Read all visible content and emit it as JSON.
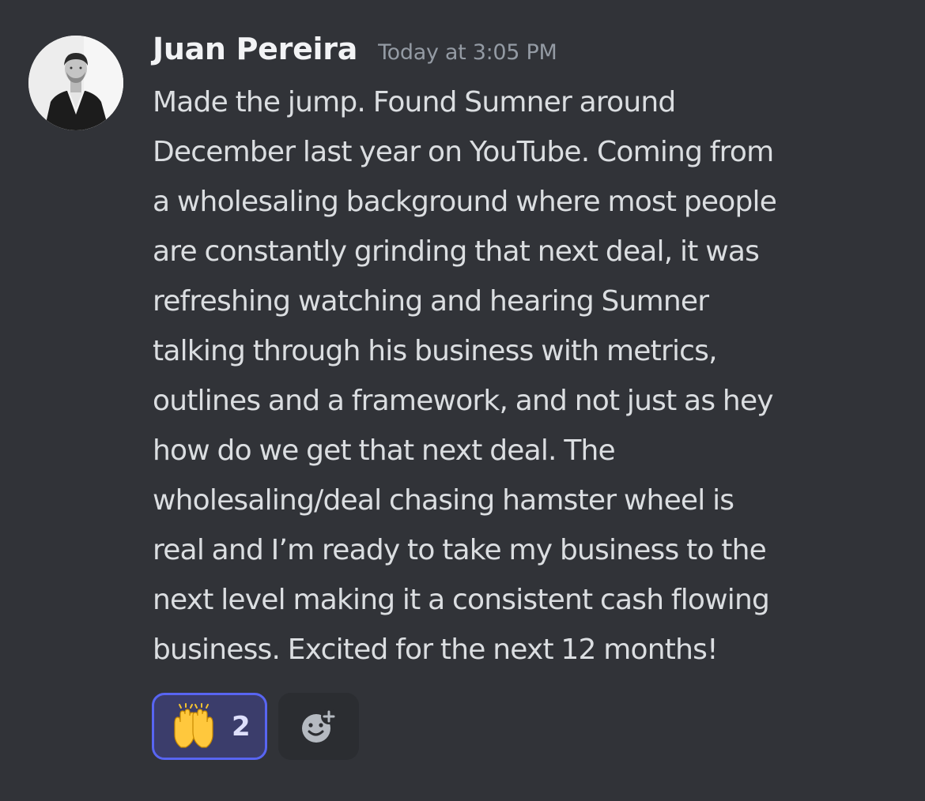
{
  "message": {
    "author": "Juan Pereira",
    "timestamp": "Today at 3:05 PM",
    "lines": [
      "Made the jump. Found Sumner around",
      "December last year on YouTube. Coming from",
      "a wholesaling background where most people",
      "are constantly grinding that next deal, it was",
      "refreshing watching and hearing Sumner",
      "talking through his business with metrics,",
      "outlines and a framework, and not just as hey",
      "how do we get that next deal. The",
      "wholesaling/deal chasing hamster wheel is",
      "real and I’m ready to take my business to the",
      "next level making it a consistent cash flowing",
      "business. Excited for the next 12 months!"
    ]
  },
  "reactions": [
    {
      "emoji": "raising-hands-emoji",
      "count": "2",
      "selected": true
    }
  ],
  "add_reaction": {
    "icon": "add-reaction-icon"
  },
  "colors": {
    "background": "#313338",
    "username": "#f2f3f5",
    "timestamp": "#949ba4",
    "text": "#dbdee1",
    "reaction_bg": "#3b3d6b",
    "reaction_border": "#5865f2",
    "add_reaction_bg": "#2b2d31"
  }
}
